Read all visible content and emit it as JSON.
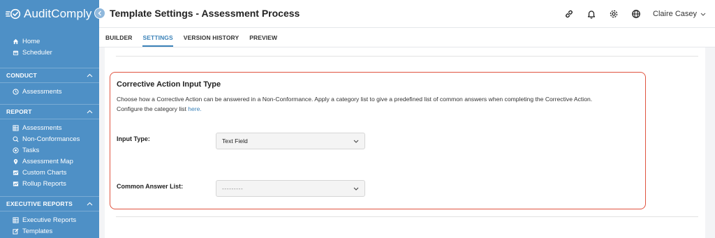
{
  "app": {
    "name": "AuditComply"
  },
  "sidebar": {
    "top_items": [
      {
        "label": "Home",
        "icon": "home-icon"
      },
      {
        "label": "Scheduler",
        "icon": "calendar-icon"
      }
    ],
    "sections": [
      {
        "title": "CONDUCT",
        "items": [
          {
            "label": "Assessments",
            "icon": "clock-icon"
          }
        ]
      },
      {
        "title": "REPORT",
        "items": [
          {
            "label": "Assessments",
            "icon": "table-icon"
          },
          {
            "label": "Non-Conformances",
            "icon": "search-alert-icon"
          },
          {
            "label": "Tasks",
            "icon": "tasks-icon"
          },
          {
            "label": "Assessment Map",
            "icon": "map-pin-icon"
          },
          {
            "label": "Custom Charts",
            "icon": "chart-icon"
          },
          {
            "label": "Rollup Reports",
            "icon": "chart-icon"
          }
        ]
      },
      {
        "title": "EXECUTIVE REPORTS",
        "items": [
          {
            "label": "Executive Reports",
            "icon": "table-icon"
          },
          {
            "label": "Templates",
            "icon": "edit-icon"
          }
        ]
      }
    ]
  },
  "header": {
    "title": "Template Settings - Assessment Process",
    "user_name": "Claire Casey",
    "icons": [
      "link-icon",
      "bell-icon",
      "gear-icon",
      "globe-icon"
    ]
  },
  "tabs": [
    {
      "label": "BUILDER",
      "active": false
    },
    {
      "label": "SETTINGS",
      "active": true
    },
    {
      "label": "VERSION HISTORY",
      "active": false
    },
    {
      "label": "PREVIEW",
      "active": false
    }
  ],
  "card": {
    "title": "Corrective Action Input Type",
    "description_line1": "Choose how a Corrective Action can be answered in a Non-Conformance. Apply a category list to give a predefined list of common answers when completing the Corrective Action.",
    "description_line2_prefix": "Configure the category list ",
    "description_link": "here.",
    "fields": [
      {
        "label": "Input Type:",
        "value": "Text Field"
      },
      {
        "label": "Common Answer List:",
        "value": "---------"
      }
    ]
  },
  "colors": {
    "sidebar_bg": "#4e90c6",
    "accent": "#3b82b8",
    "highlight_border": "#e0533f"
  }
}
